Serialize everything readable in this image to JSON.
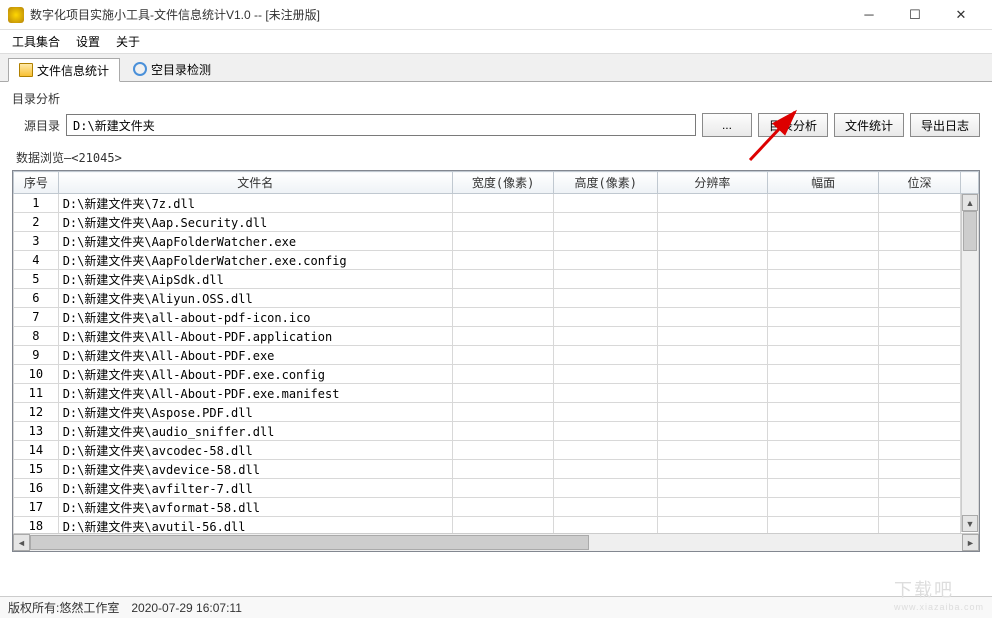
{
  "window": {
    "title": "数字化项目实施小工具-文件信息统计V1.0 -- [未注册版]"
  },
  "menubar": {
    "items": [
      "工具集合",
      "设置",
      "关于"
    ]
  },
  "tabs": [
    {
      "label": "文件信息统计",
      "icon": "folder-icon",
      "active": true
    },
    {
      "label": "空目录检测",
      "icon": "refresh-icon",
      "active": false
    }
  ],
  "dirSection": {
    "group_label": "目录分析",
    "src_label": "源目录",
    "src_value": "D:\\新建文件夹",
    "browse_label": "...",
    "analyze_label": "目录分析",
    "stats_label": "文件统计",
    "export_label": "导出日志"
  },
  "dataBrowser": {
    "label": "数据浏览—<21045>",
    "columns": [
      "序号",
      "文件名",
      "宽度(像素)",
      "高度(像素)",
      "分辨率",
      "幅面",
      "位深"
    ],
    "rows": [
      {
        "seq": "1",
        "name": "D:\\新建文件夹\\7z.dll"
      },
      {
        "seq": "2",
        "name": "D:\\新建文件夹\\Aap.Security.dll"
      },
      {
        "seq": "3",
        "name": "D:\\新建文件夹\\AapFolderWatcher.exe"
      },
      {
        "seq": "4",
        "name": "D:\\新建文件夹\\AapFolderWatcher.exe.config"
      },
      {
        "seq": "5",
        "name": "D:\\新建文件夹\\AipSdk.dll"
      },
      {
        "seq": "6",
        "name": "D:\\新建文件夹\\Aliyun.OSS.dll"
      },
      {
        "seq": "7",
        "name": "D:\\新建文件夹\\all-about-pdf-icon.ico"
      },
      {
        "seq": "8",
        "name": "D:\\新建文件夹\\All-About-PDF.application"
      },
      {
        "seq": "9",
        "name": "D:\\新建文件夹\\All-About-PDF.exe"
      },
      {
        "seq": "10",
        "name": "D:\\新建文件夹\\All-About-PDF.exe.config"
      },
      {
        "seq": "11",
        "name": "D:\\新建文件夹\\All-About-PDF.exe.manifest"
      },
      {
        "seq": "12",
        "name": "D:\\新建文件夹\\Aspose.PDF.dll"
      },
      {
        "seq": "13",
        "name": "D:\\新建文件夹\\audio_sniffer.dll"
      },
      {
        "seq": "14",
        "name": "D:\\新建文件夹\\avcodec-58.dll"
      },
      {
        "seq": "15",
        "name": "D:\\新建文件夹\\avdevice-58.dll"
      },
      {
        "seq": "16",
        "name": "D:\\新建文件夹\\avfilter-7.dll"
      },
      {
        "seq": "17",
        "name": "D:\\新建文件夹\\avformat-58.dll"
      },
      {
        "seq": "18",
        "name": "D:\\新建文件夹\\avutil-56.dll"
      }
    ]
  },
  "statusbar": {
    "copyright": "版权所有:悠然工作室",
    "timestamp": "2020-07-29 16:07:11"
  },
  "watermark": {
    "main": "下载吧",
    "sub": "www.xiazaiba.com"
  }
}
